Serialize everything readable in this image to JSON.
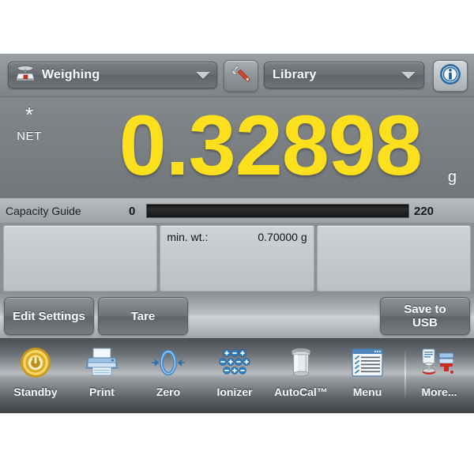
{
  "topbar": {
    "mode_dropdown": {
      "label": "Weighing",
      "icon": "balance-scale-icon",
      "arrow_icon": "chevron-down-icon"
    },
    "settings_button": {
      "icon": "wrench-icon"
    },
    "library_dropdown": {
      "label": "Library",
      "arrow_icon": "chevron-down-icon"
    },
    "info_button": {
      "icon": "info-circle-icon"
    }
  },
  "display": {
    "stability_indicator": "*",
    "net_indicator": "NET",
    "weight_value": "0.32898",
    "weight_unit": "g"
  },
  "capacity": {
    "label": "Capacity Guide",
    "min": "0",
    "max": "220",
    "fill_percent": 0
  },
  "panels": [
    {
      "key": "",
      "value": ""
    },
    {
      "key": "min. wt.:",
      "value": "0.70000 g"
    },
    {
      "key": "",
      "value": ""
    }
  ],
  "actions": {
    "edit_settings": "Edit Settings",
    "tare": "Tare",
    "save_to_usb": "Save to\nUSB",
    "save_to_usb_line1": "Save to",
    "save_to_usb_line2": "USB"
  },
  "nav": [
    {
      "label": "Standby",
      "icon": "power-standby-icon"
    },
    {
      "label": "Print",
      "icon": "printer-icon"
    },
    {
      "label": "Zero",
      "icon": "zero-icon"
    },
    {
      "label": "Ionizer",
      "icon": "ionizer-icon"
    },
    {
      "label": "AutoCal™",
      "icon": "calibration-weight-icon"
    },
    {
      "label": "Menu",
      "icon": "menu-window-icon"
    },
    {
      "label": "More...",
      "icon": "more-applications-icon"
    }
  ],
  "colors": {
    "weight_yellow": "#fcdf1d",
    "accent_blue": "#2f6fab",
    "standby_gold": "#e8b92a",
    "wrench_red": "#d4442a",
    "panel_bg": "#c6c9cb",
    "screen_gray": "#7f8488"
  }
}
